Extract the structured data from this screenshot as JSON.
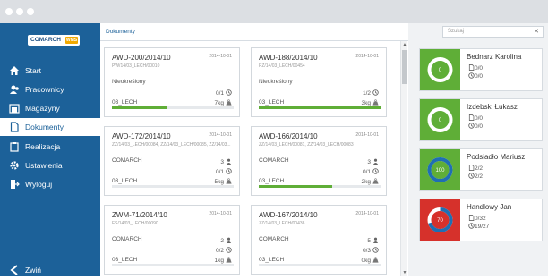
{
  "app": {
    "logo_text": "COMARCH",
    "logo_badge": "WMS"
  },
  "sidebar": {
    "items": [
      {
        "label": "Start",
        "icon": "home-icon"
      },
      {
        "label": "Pracownicy",
        "icon": "users-icon"
      },
      {
        "label": "Magazyny",
        "icon": "warehouse-icon"
      },
      {
        "label": "Dokumenty",
        "icon": "document-icon",
        "active": true
      },
      {
        "label": "Realizacja",
        "icon": "clipboard-icon"
      },
      {
        "label": "Ustawienia",
        "icon": "gear-icon"
      },
      {
        "label": "Wyloguj",
        "icon": "logout-icon"
      }
    ],
    "back_label": "Zwiń"
  },
  "breadcrumb": "Dokumenty",
  "documents": [
    {
      "title": "AWD-200/2014/10",
      "date": "2014-10-01",
      "ref": "PW/14/03_LECH/00010",
      "customer": "Nieokreślony",
      "count": "",
      "progress": "0/1",
      "store": "03_LECH",
      "weight": "7kg",
      "fill": 0.45
    },
    {
      "title": "AWD-188/2014/10",
      "date": "2014-10-01",
      "ref": "PZ/14/03_LECH/00454",
      "customer": "Nieokreślony",
      "count": "",
      "progress": "1/2",
      "store": "03_LECH",
      "weight": "3kg",
      "fill": 1.0
    },
    {
      "title": "AWD-172/2014/10",
      "date": "2014-10-01",
      "ref": "ZZ/14/03_LECH/00084, ZZ/14/03_LECH/00085, ZZ/14/03...",
      "customer": "COMARCH",
      "count": "3",
      "progress": "0/1",
      "store": "03_LECH",
      "weight": "5kg",
      "fill": 0.0
    },
    {
      "title": "AWD-166/2014/10",
      "date": "2014-10-01",
      "ref": "ZZ/14/03_LECH/00081, ZZ/14/03_LECH/00083",
      "customer": "COMARCH",
      "count": "3",
      "progress": "0/1",
      "store": "03_LECH",
      "weight": "2kg",
      "fill": 0.6
    },
    {
      "title": "ZWM-71/2014/10",
      "date": "2014-10-01",
      "ref": "FS/14/03_LECH/00090",
      "customer": "COMARCH",
      "count": "2",
      "progress": "0/2",
      "store": "03_LECH",
      "weight": "1kg",
      "fill": 0.0
    },
    {
      "title": "AWD-167/2014/10",
      "date": "2014-10-01",
      "ref": "ZZ/14/03_LECH/00436",
      "customer": "COMARCH",
      "count": "5",
      "progress": "0/3",
      "store": "03_LECH",
      "weight": "0kg",
      "fill": 0.0
    }
  ],
  "search": {
    "placeholder": "Szukaj",
    "clear_icon": "close-icon"
  },
  "people": [
    {
      "name": "Bednarz Karolina",
      "docs": "0/0",
      "tasks": "0/0",
      "color": "#5fae37",
      "percent": "0",
      "percent_value": 0
    },
    {
      "name": "Izdebski Łukasz",
      "docs": "0/0",
      "tasks": "0/0",
      "color": "#5fae37",
      "percent": "0",
      "percent_value": 0
    },
    {
      "name": "Podsiadło Mariusz",
      "docs": "2/2",
      "tasks": "2/2",
      "color": "#5fae37",
      "percent": "100",
      "percent_value": 100
    },
    {
      "name": "Handlowy Jan",
      "docs": "0/32",
      "tasks": "19/27",
      "color": "#d6312b",
      "percent": "70",
      "percent_value": 70
    }
  ]
}
